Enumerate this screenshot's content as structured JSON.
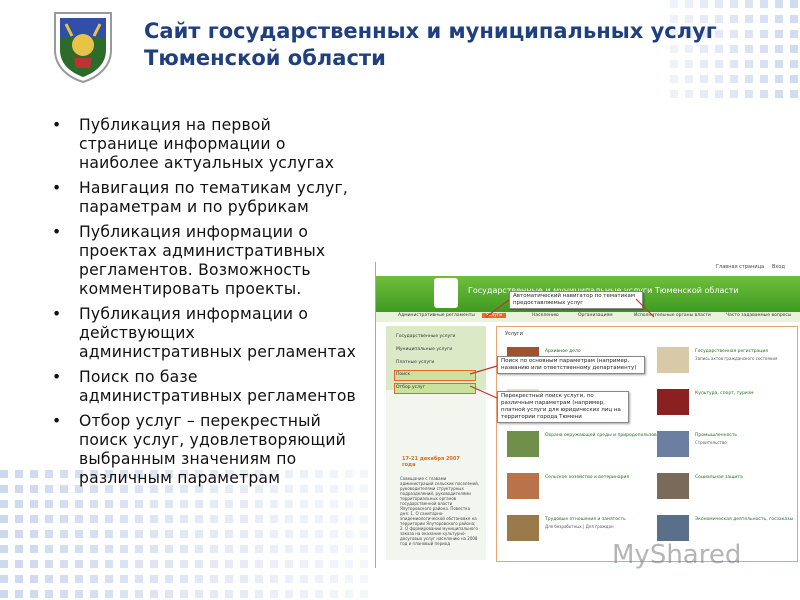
{
  "slide": {
    "title_line1": "Сайт государственных и муниципальных услуг",
    "title_line2": "Тюменской области",
    "bullets": [
      [
        "Публикация на первой",
        "странице информации о",
        "наиболее актуальных услугах"
      ],
      [
        "Навигация по тематикам услуг,",
        "параметрам и по рубрикам"
      ],
      [
        "Публикация информации о",
        "проектах административных",
        "регламентов. Возможность",
        "комментировать проекты."
      ],
      [
        "Публикация информации  о",
        "действующих",
        "административных регламентах"
      ],
      [
        "Поиск по базе",
        "административных регламентов"
      ],
      [
        "Отбор услуг – перекрестный",
        "поиск услуг, удовлетворяющий",
        "выбранным значениям по",
        "различным параметрам"
      ]
    ],
    "bullet_char": "•",
    "accent_color": "#1f3f7f"
  },
  "screenshot": {
    "top_links": [
      "Главная страница",
      "Вход"
    ],
    "site_name": "Государственные и муниципальные услуги Тюменской области",
    "nav": [
      "Административные регламенты",
      "Услуги",
      "Населению",
      "Организациям",
      "Исполнительные органы власти",
      "Часто задаваемые вопросы"
    ],
    "side_items": [
      "Государственные услуги",
      "Муниципальные услуги",
      "Платные услуги",
      "Поиск",
      "Отбор услуг"
    ],
    "news_date": "17-21 декабря 2007 года",
    "news_text": "Совещание с главами администраций сельских поселений, руководителями структурных подразделений, руководителями территориальных органов государственной власти Ялуторовского района. Повестка дня: 1. О санитарно-эпидемиологической обстановке на территории Ялуторовского района; 2. О формировании муниципального заказа на оказание культурно-досуговых услуг населению на 2008 год и плановый период",
    "main_header": "Услуги",
    "categories": [
      {
        "title": "Архивное дело",
        "sub": ""
      },
      {
        "title": "Государственная регистрация",
        "sub": "Запись актов гражданского состояния"
      },
      {
        "title": "",
        "sub": "СМСБ | Иностранные граждане"
      },
      {
        "title": "Культура, спорт, туризм",
        "sub": ""
      },
      {
        "title": "Охрана окружающей среды и природопользование",
        "sub": ""
      },
      {
        "title": "Промышленность",
        "sub": "Строительство"
      },
      {
        "title": "Сельское хозяйство и ветеринария",
        "sub": ""
      },
      {
        "title": "Социальная защита",
        "sub": ""
      },
      {
        "title": "Трудовые отношения и занятость",
        "sub": "Для безработных | Для граждан"
      },
      {
        "title": "Экономическая деятельность, госзаказы",
        "sub": ""
      }
    ],
    "callouts": [
      "Автоматический навигатор по тематикам предоставляемых услуг",
      "Поиск по основным параметрам (например, названию или ответственному департаменту)",
      "Перекрестный поиск услуги, по различным параметрам (например, платной услуги для юридических лиц на территории города Тюмени"
    ]
  },
  "watermark": "MyShared"
}
